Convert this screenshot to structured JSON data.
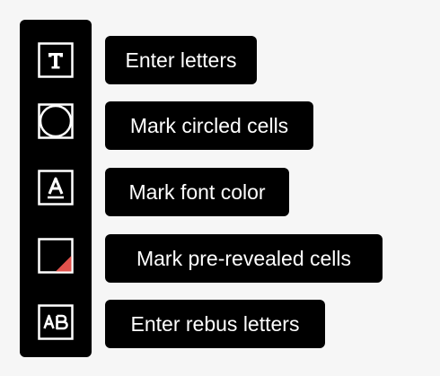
{
  "toolbar": {
    "tools": [
      {
        "icon": "text-t-icon",
        "label": "Enter letters"
      },
      {
        "icon": "circle-icon",
        "label": "Mark circled cells"
      },
      {
        "icon": "font-color-a-icon",
        "label": "Mark font color"
      },
      {
        "icon": "pre-revealed-cell-icon",
        "label": "Mark pre-revealed cells"
      },
      {
        "icon": "rebus-ab-icon",
        "label": "Enter rebus letters"
      }
    ]
  },
  "colors": {
    "background": "#f6f6f6",
    "toolbar": "#000000",
    "icon_stroke": "#ffffff",
    "revealed_corner": "#e0514b"
  }
}
